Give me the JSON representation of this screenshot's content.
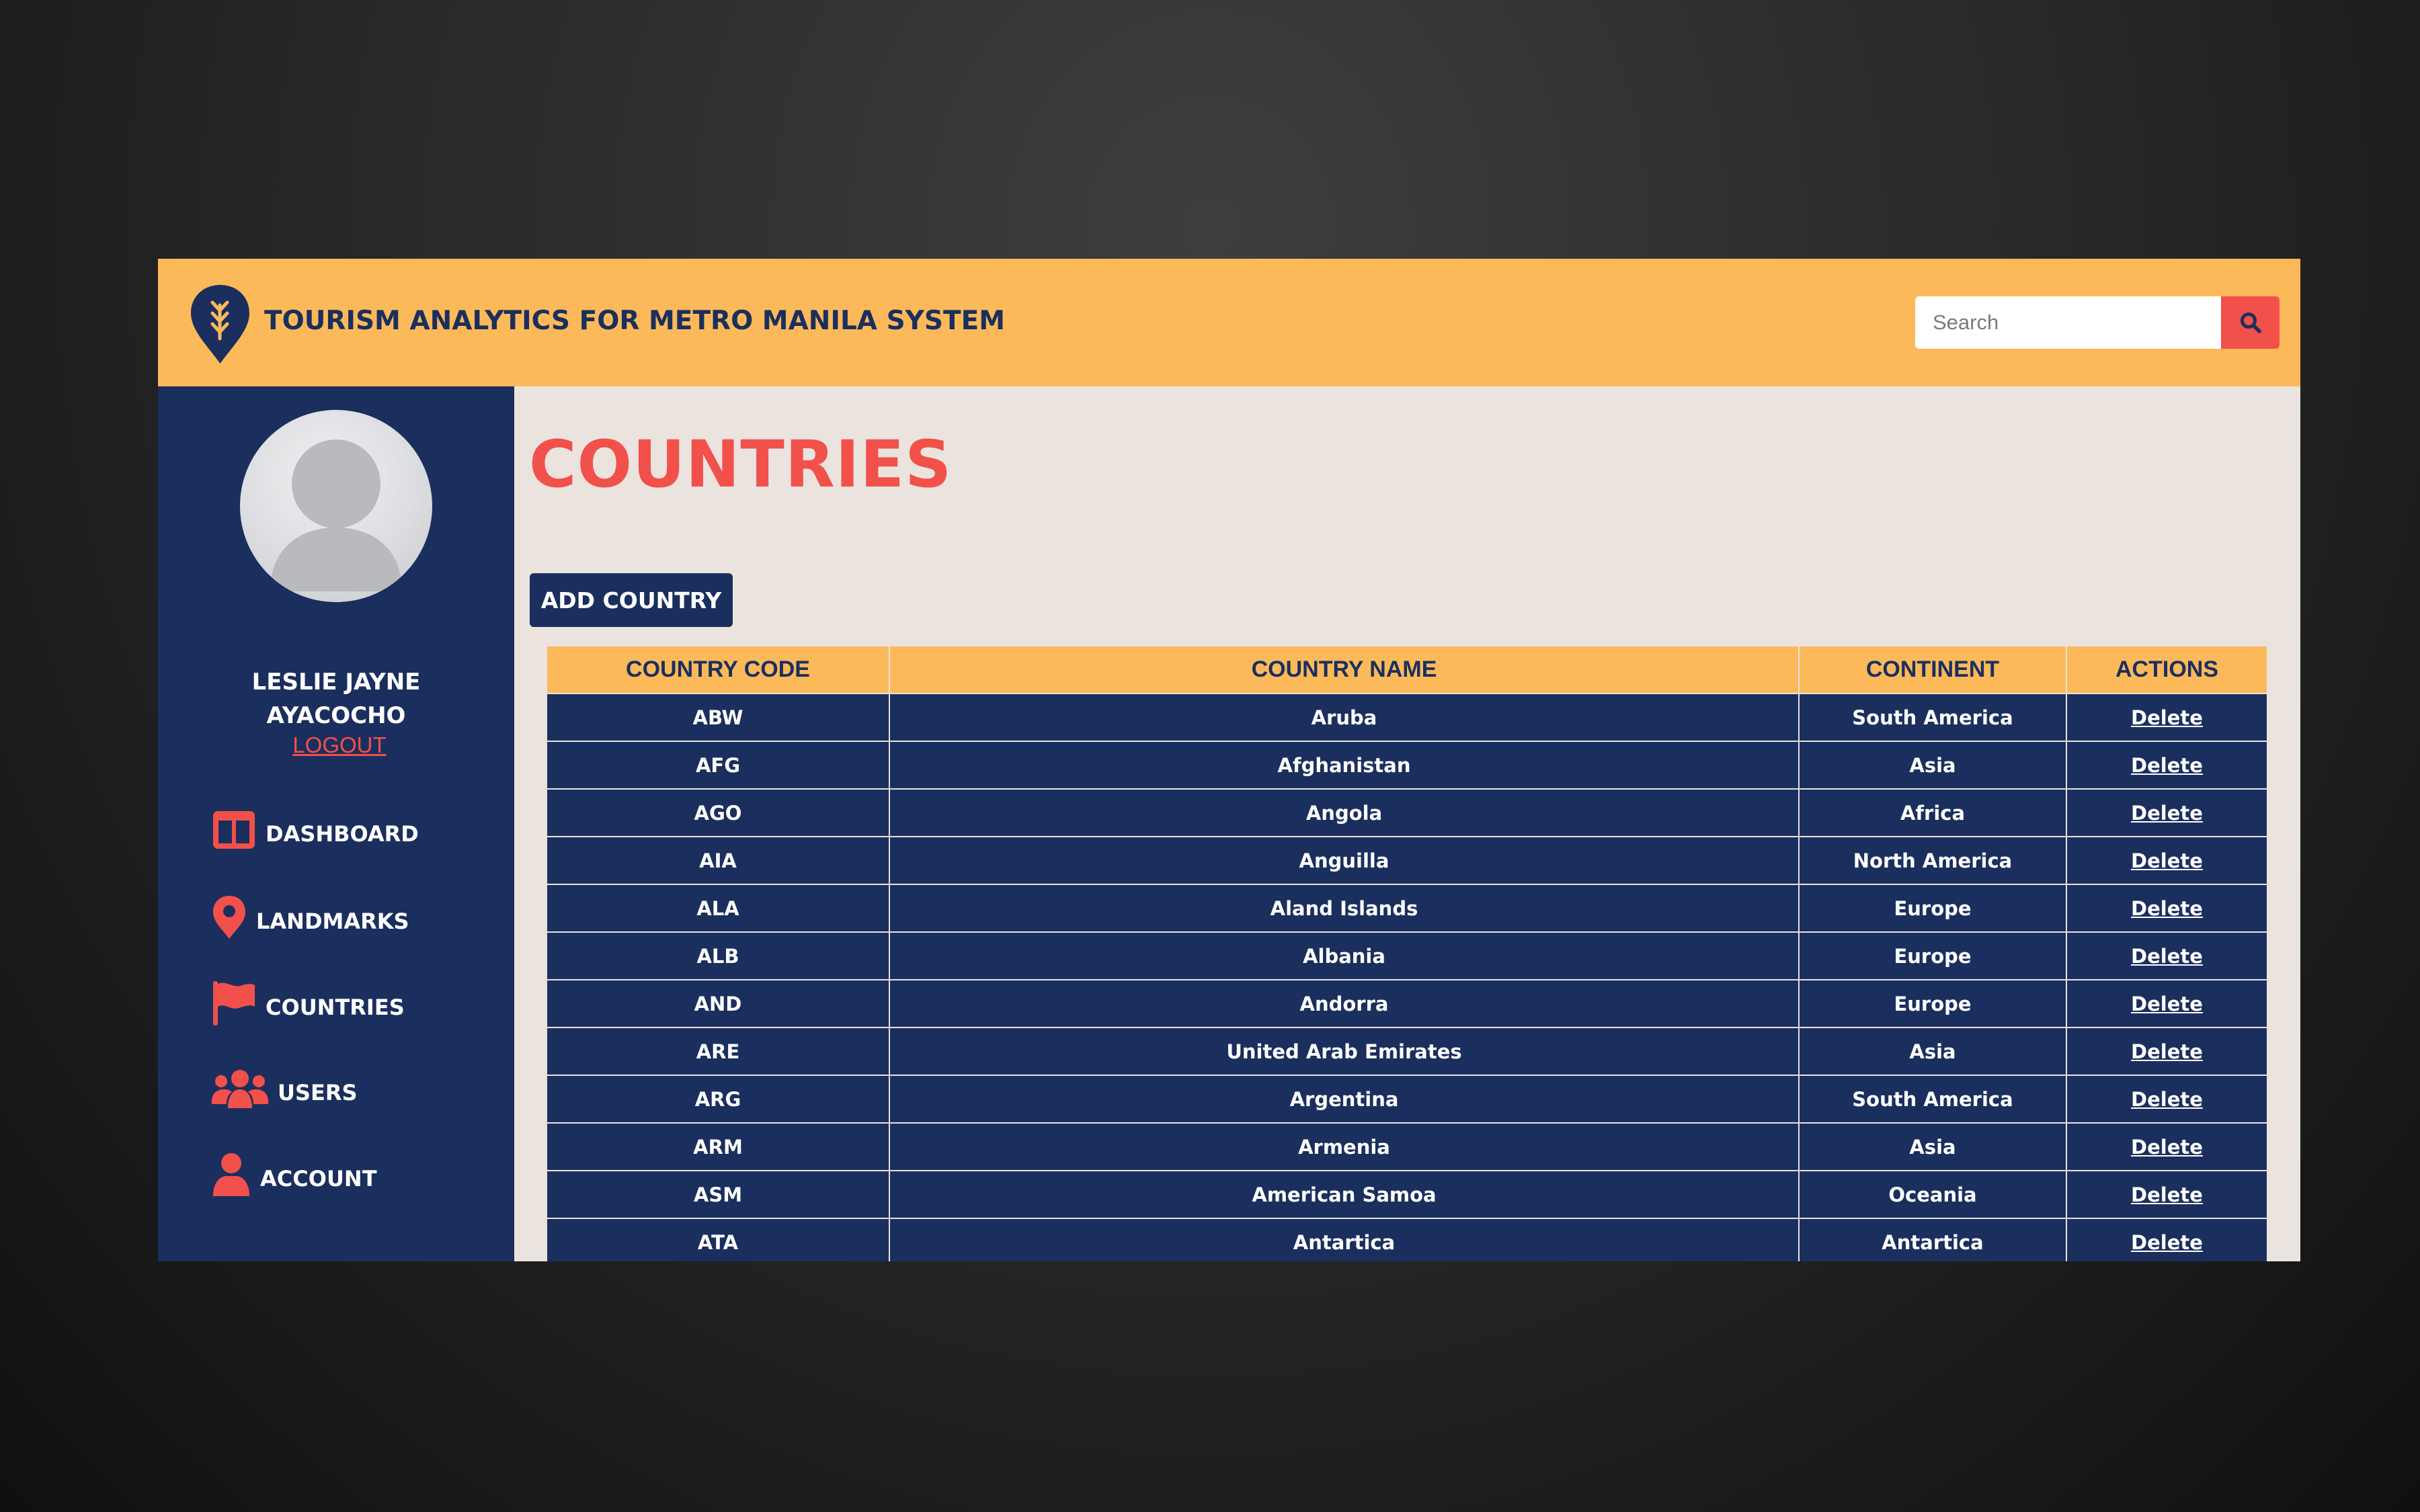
{
  "header": {
    "title": "TOURISM ANALYTICS FOR METRO MANILA SYSTEM",
    "logo_icon": "map-pin-logo",
    "search": {
      "placeholder": "Search",
      "value": "",
      "button_icon": "search-icon"
    }
  },
  "sidebar": {
    "user_name": "LESLIE JAYNE AYACOCHO",
    "logout_label": "LOGOUT",
    "nav": [
      {
        "label": "DASHBOARD",
        "icon": "dashboard-icon"
      },
      {
        "label": "LANDMARKS",
        "icon": "map-marker-icon"
      },
      {
        "label": "COUNTRIES",
        "icon": "flag-icon"
      },
      {
        "label": "USERS",
        "icon": "users-icon"
      },
      {
        "label": "ACCOUNT",
        "icon": "user-icon"
      }
    ]
  },
  "main": {
    "title": "COUNTRIES",
    "add_button_label": "ADD COUNTRY",
    "table": {
      "headers": [
        "COUNTRY CODE",
        "COUNTRY NAME",
        "CONTINENT",
        "ACTIONS"
      ],
      "rows": [
        {
          "code": "ABW",
          "name": "Aruba",
          "continent": "South America",
          "action": "Delete"
        },
        {
          "code": "AFG",
          "name": "Afghanistan",
          "continent": "Asia",
          "action": "Delete"
        },
        {
          "code": "AGO",
          "name": "Angola",
          "continent": "Africa",
          "action": "Delete"
        },
        {
          "code": "AIA",
          "name": "Anguilla",
          "continent": "North America",
          "action": "Delete"
        },
        {
          "code": "ALA",
          "name": "Aland Islands",
          "continent": "Europe",
          "action": "Delete"
        },
        {
          "code": "ALB",
          "name": "Albania",
          "continent": "Europe",
          "action": "Delete"
        },
        {
          "code": "AND",
          "name": "Andorra",
          "continent": "Europe",
          "action": "Delete"
        },
        {
          "code": "ARE",
          "name": "United Arab Emirates",
          "continent": "Asia",
          "action": "Delete"
        },
        {
          "code": "ARG",
          "name": "Argentina",
          "continent": "South America",
          "action": "Delete"
        },
        {
          "code": "ARM",
          "name": "Armenia",
          "continent": "Asia",
          "action": "Delete"
        },
        {
          "code": "ASM",
          "name": "American Samoa",
          "continent": "Oceania",
          "action": "Delete"
        },
        {
          "code": "ATA",
          "name": "Antartica",
          "continent": "Antartica",
          "action": "Delete"
        }
      ]
    }
  },
  "colors": {
    "header_bg": "#fbb95a",
    "navy": "#1b2f5e",
    "accent_red": "#f2504a",
    "content_bg": "#ebe3de"
  }
}
